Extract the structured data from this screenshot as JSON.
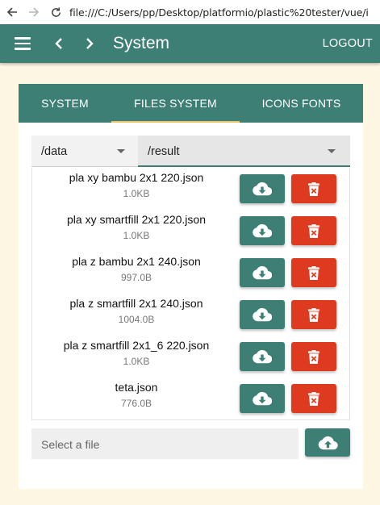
{
  "browser": {
    "url": "file:///C:/Users/pp/Desktop/platformio/plastic%20tester/vue/i"
  },
  "header": {
    "title": "System",
    "logout_label": "LOGOUT"
  },
  "tabs": [
    {
      "label": "SYSTEM",
      "active": false
    },
    {
      "label": "FILES SYSTEM",
      "active": true
    },
    {
      "label": "ICONS FONTS",
      "active": false
    }
  ],
  "selects": {
    "folder": "/data",
    "subfolder": "/result"
  },
  "files": [
    {
      "name": "pla xy bambu 2x1 220.json",
      "size": "1.0KB"
    },
    {
      "name": "pla xy smartfill 2x1 220.json",
      "size": "1.0KB"
    },
    {
      "name": "pla z bambu 2x1 240.json",
      "size": "997.0B"
    },
    {
      "name": "pla z smartfill 2x1 240.json",
      "size": "1004.0B"
    },
    {
      "name": "pla z smartfill 2x1_6 220.json",
      "size": "1.0KB"
    },
    {
      "name": "teta.json",
      "size": "776.0B"
    }
  ],
  "upload": {
    "placeholder": "Select a file"
  },
  "icons": {
    "download": "cloud-download-icon",
    "delete": "trash-can-icon",
    "upload": "cloud-upload-icon"
  },
  "colors": {
    "primary": "#3d7f74",
    "danger": "#de3a20",
    "tab_indicator": "#e9c46a",
    "page_background": "#fdf6e3"
  }
}
